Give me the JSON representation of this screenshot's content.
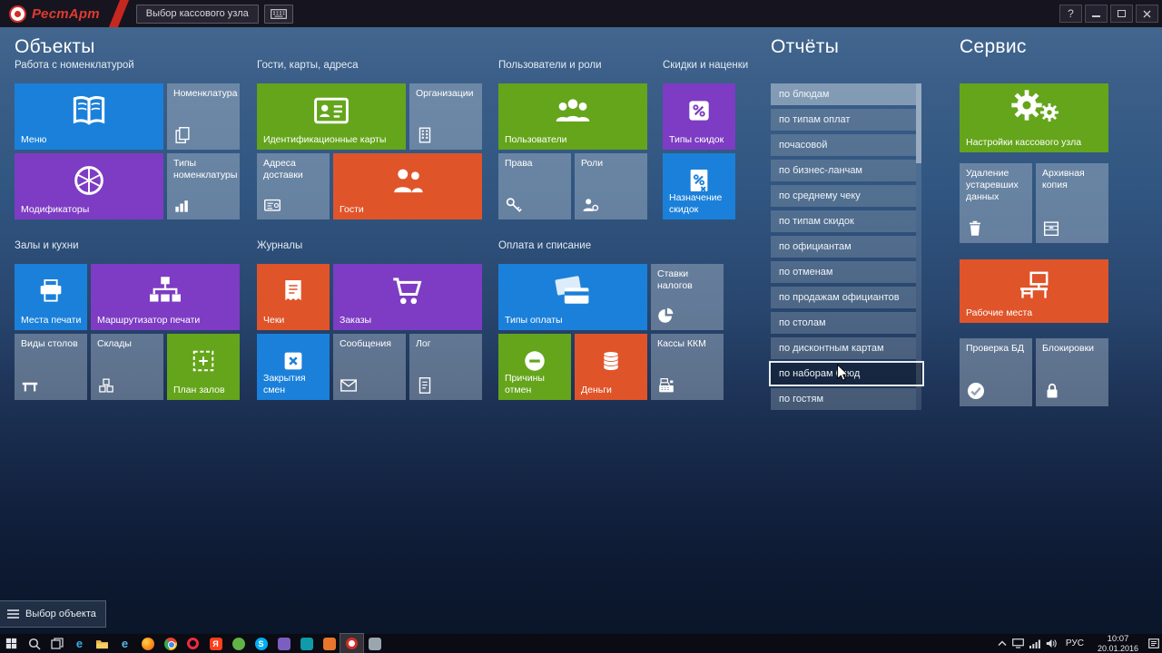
{
  "palette": {
    "tile_blue": "#1b80da",
    "tile_purple": "#7d3cc3",
    "tile_green": "#64a51b",
    "tile_orange": "#e0542a",
    "tile_gray": "rgba(182,196,210,0.42)",
    "brand_red": "#d22d26",
    "background_top": "#466a92",
    "background_bottom": "#0a1526"
  },
  "titlebar": {
    "app_name": "РестАрт",
    "cash_node_button": "Выбор кассового узла",
    "help_button": "?"
  },
  "objects": {
    "title": "Объекты",
    "groups": [
      {
        "name": "Работа с номенклатурой",
        "tiles": [
          {
            "label": "Меню",
            "icon": "menu-book-icon",
            "color": "blue"
          },
          {
            "label": "Номенклатура",
            "icon": "pages-icon",
            "color": "gray"
          },
          {
            "label": "Модификаторы",
            "icon": "citrus-slice-icon",
            "color": "purple"
          },
          {
            "label": "Типы номенклатуры",
            "icon": "bar-chart-icon",
            "color": "gray"
          }
        ]
      },
      {
        "name": "Гости, карты, адреса",
        "tiles": [
          {
            "label": "Идентификационные карты",
            "icon": "id-card-icon",
            "color": "green"
          },
          {
            "label": "Организации",
            "icon": "building-icon",
            "color": "gray"
          },
          {
            "label": "Адреса доставки",
            "icon": "address-card-icon",
            "color": "gray"
          },
          {
            "label": "Гости",
            "icon": "people-icon",
            "color": "orange"
          }
        ]
      },
      {
        "name": "Пользователи и роли",
        "tiles": [
          {
            "label": "Пользователи",
            "icon": "people-group-icon",
            "color": "green"
          },
          {
            "label": "Права",
            "icon": "key-icon",
            "color": "gray"
          },
          {
            "label": "Роли",
            "icon": "person-role-icon",
            "color": "gray"
          }
        ]
      },
      {
        "name": "Скидки и наценки",
        "tiles": [
          {
            "label": "Типы скидок",
            "icon": "percent-icon",
            "color": "purple"
          },
          {
            "label": "Назначение скидок",
            "icon": "document-percent-icon",
            "color": "blue"
          }
        ]
      },
      {
        "name": "Залы и кухни",
        "tiles": [
          {
            "label": "Места печати",
            "icon": "printer-icon",
            "color": "blue"
          },
          {
            "label": "Маршрутизатор печати",
            "icon": "tree-icon",
            "color": "purple"
          },
          {
            "label": "Виды столов",
            "icon": "table-icon",
            "color": "gray"
          },
          {
            "label": "Склады",
            "icon": "boxes-icon",
            "color": "gray"
          },
          {
            "label": "План залов",
            "icon": "floor-plan-icon",
            "color": "green"
          }
        ]
      },
      {
        "name": "Журналы",
        "tiles": [
          {
            "label": "Чеки",
            "icon": "receipt-icon",
            "color": "orange"
          },
          {
            "label": "Заказы",
            "icon": "cart-icon",
            "color": "purple"
          },
          {
            "label": "Закрытия смен",
            "icon": "box-x-icon",
            "color": "blue"
          },
          {
            "label": "Сообщения",
            "icon": "envelope-icon",
            "color": "gray"
          },
          {
            "label": "Лог",
            "icon": "log-icon",
            "color": "gray"
          }
        ]
      },
      {
        "name": "Оплата и списание",
        "tiles": [
          {
            "label": "Типы оплаты",
            "icon": "cards-icon",
            "color": "blue"
          },
          {
            "label": "Ставки налогов",
            "icon": "pie-icon",
            "color": "gray"
          },
          {
            "label": "Причины отмен",
            "icon": "minus-circle-icon",
            "color": "green"
          },
          {
            "label": "Деньги",
            "icon": "coins-icon",
            "color": "orange"
          },
          {
            "label": "Кассы ККМ",
            "icon": "cash-register-icon",
            "color": "gray"
          }
        ]
      }
    ]
  },
  "reports": {
    "title": "Отчёты",
    "items": [
      "по блюдам",
      "по типам оплат",
      "почасовой",
      "по бизнес-ланчам",
      "по среднему чеку",
      "по типам скидок",
      "по официантам",
      "по отменам",
      "по продажам официантов",
      "по столам",
      "по дисконтным картам",
      "по наборам блюд",
      "по гостям"
    ],
    "highlighted_item": "по наборам блюд"
  },
  "service": {
    "title": "Сервис",
    "tiles": [
      {
        "label": "Настройки кассового узла",
        "icon": "gears-icon",
        "color": "green"
      },
      {
        "label": "Удаление устаревших данных",
        "icon": "trash-icon",
        "color": "gray"
      },
      {
        "label": "Архивная копия",
        "icon": "archive-icon",
        "color": "gray"
      },
      {
        "label": "Рабочие места",
        "icon": "workstation-icon",
        "color": "orange"
      },
      {
        "label": "Проверка БД",
        "icon": "check-circle-icon",
        "color": "gray"
      },
      {
        "label": "Блокировки",
        "icon": "lock-icon",
        "color": "gray"
      }
    ]
  },
  "bottom_bar": {
    "label": "Выбор объекта"
  },
  "taskbar": {
    "language": "РУС",
    "time": "10:07",
    "date": "20.01.2016",
    "icons": [
      "start",
      "search",
      "task-view",
      "edge",
      "file-explorer",
      "internet-explorer",
      "firefox",
      "chrome",
      "opera",
      "yandex-browser",
      "green-app",
      "skype",
      "purple-app",
      "teal-app",
      "orange-app",
      "restart-app",
      "gray-app",
      "tray-expand",
      "display",
      "network",
      "volume",
      "language",
      "clock",
      "action-center"
    ]
  }
}
